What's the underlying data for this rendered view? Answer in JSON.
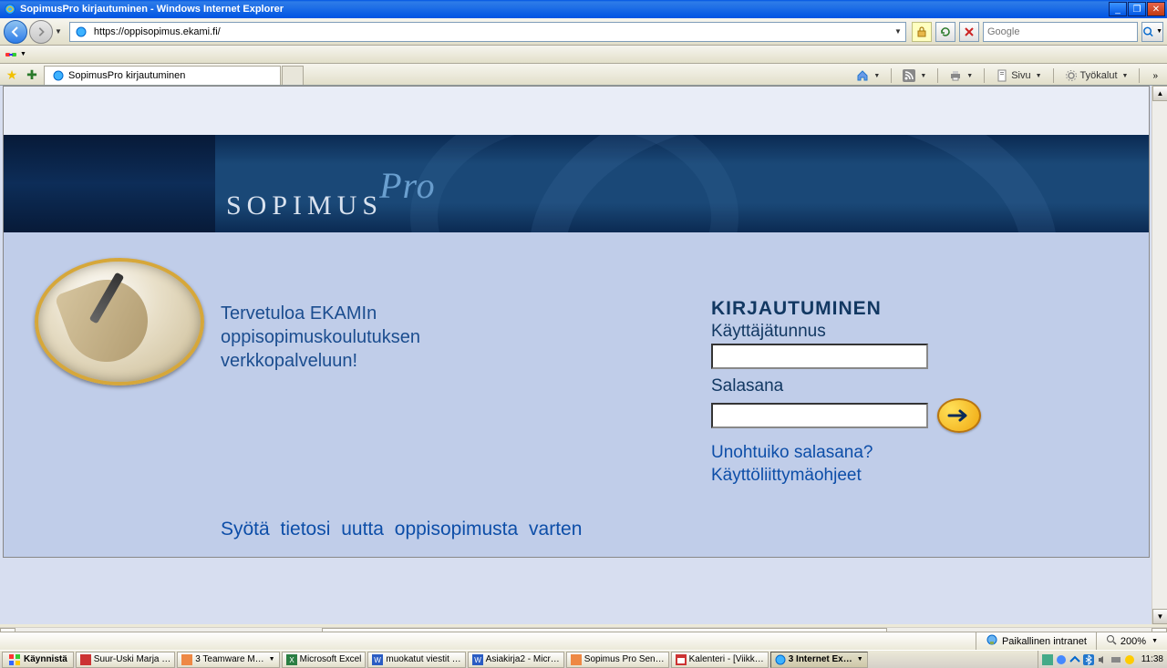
{
  "window": {
    "title": "SopimusPro kirjautuminen - Windows Internet Explorer"
  },
  "address": {
    "url": "https://oppisopimus.ekami.fi/"
  },
  "search": {
    "placeholder": "Google"
  },
  "tab": {
    "title": "SopimusPro kirjautuminen"
  },
  "tabbar_right": {
    "sivu": "Sivu",
    "tyokalut": "Työkalut"
  },
  "brand": {
    "main": "SOPIMUS",
    "sub": "Pro"
  },
  "welcome": {
    "line1": "Tervetuloa EKAMIn",
    "line2": "oppisopimuskoulutuksen",
    "line3": "verkkopalveluun!"
  },
  "login": {
    "title": "KIRJAUTUMINEN",
    "username_label": "Käyttäjätunnus",
    "username_value": "",
    "password_label": "Salasana",
    "password_value": "",
    "forgot": "Unohtuiko salasana?",
    "help": "Käyttöliittymäohjeet"
  },
  "bottom_link": "Syötä tietosi uutta oppisopimusta varten",
  "statusbar": {
    "zone": "Paikallinen intranet",
    "zoom": "200%"
  },
  "taskbar": {
    "start": "Käynnistä",
    "items": [
      "Suur-Uski Marja …",
      "3 Teamware M…",
      "Microsoft Excel",
      "muokatut viestit …",
      "Asiakirja2 - Micr…",
      "Sopimus Pro Sen…",
      "Kalenteri - [Viikk…",
      "3 Internet Ex…"
    ],
    "clock": "11:38"
  }
}
